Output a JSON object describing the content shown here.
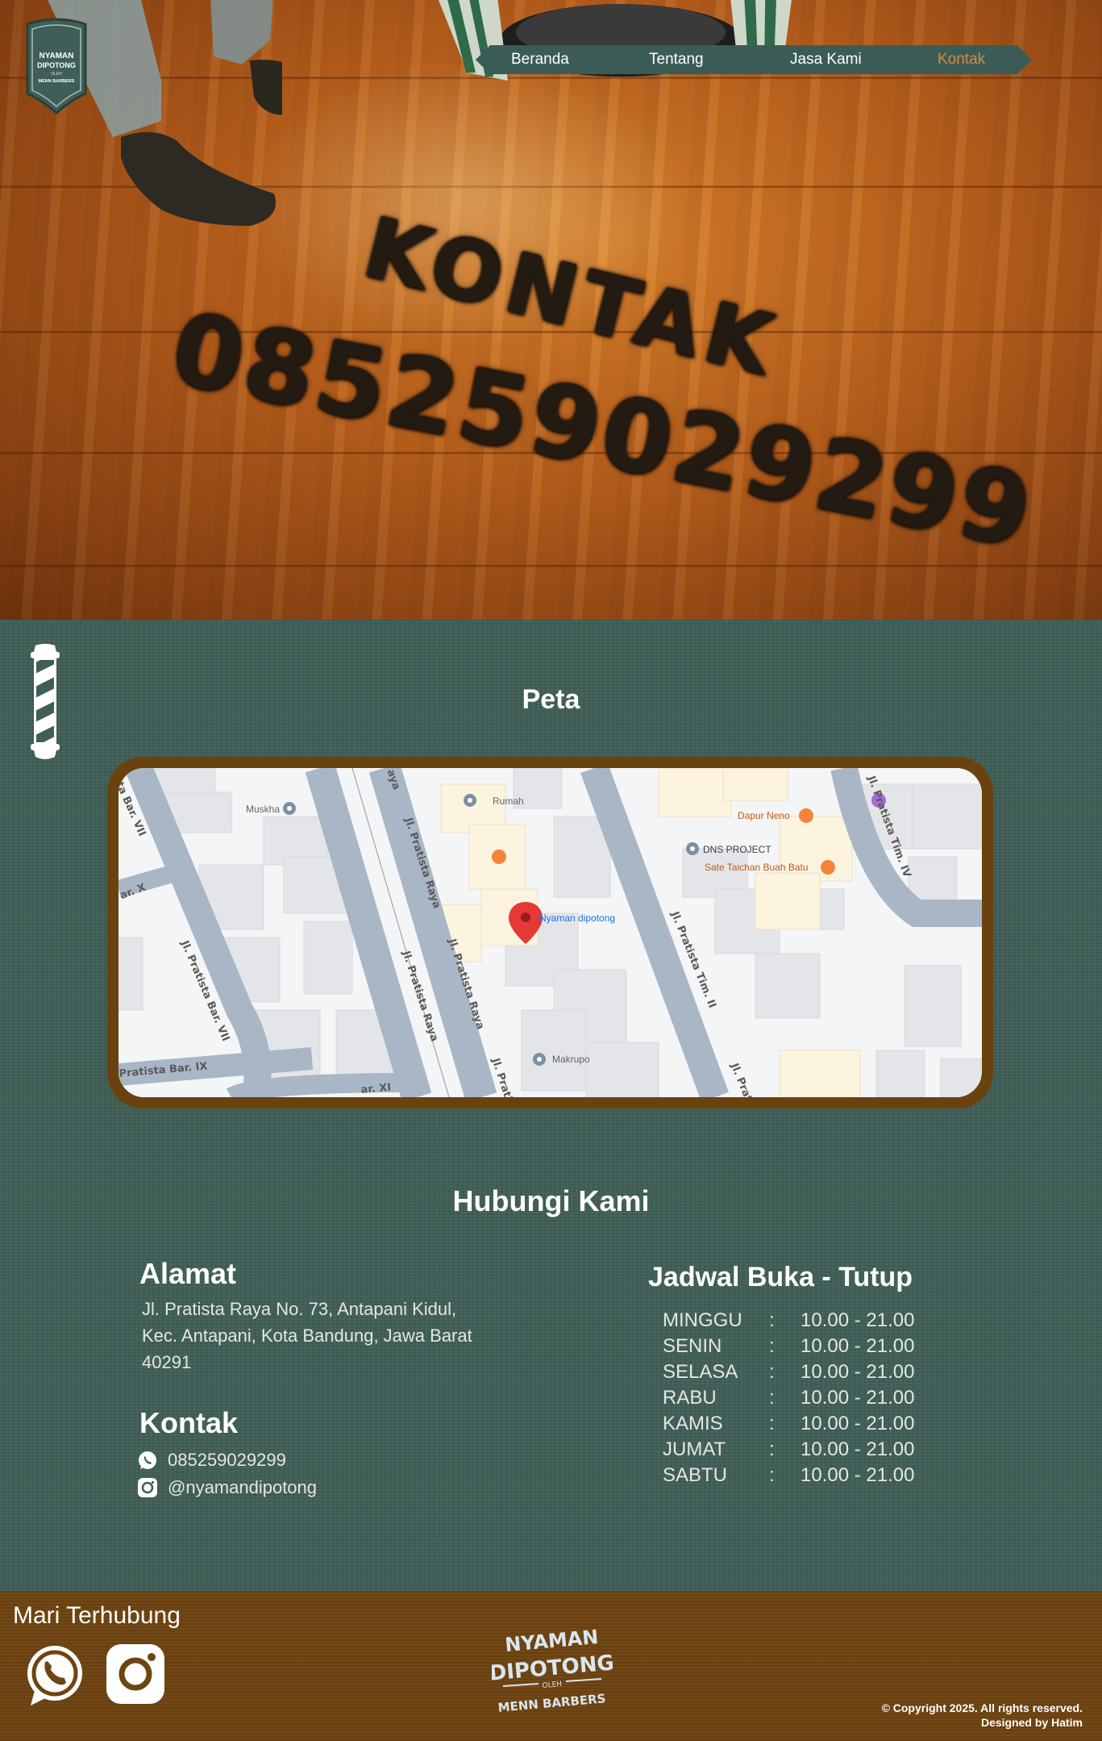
{
  "nav": {
    "items": [
      {
        "label": "Beranda",
        "active": false
      },
      {
        "label": "Tentang",
        "active": false
      },
      {
        "label": "Jasa Kami",
        "active": false
      },
      {
        "label": "Kontak",
        "active": true
      }
    ]
  },
  "logo": {
    "line1": "NYAMAN",
    "line2": "DIPOTONG",
    "line3": "OLEH",
    "line4": "MENN BARBERS"
  },
  "hero": {
    "headline": "KONTAK",
    "phone": "085259029299"
  },
  "peta": {
    "title": "Peta",
    "places": {
      "muskha": "Muskha",
      "rumah": "Rumah",
      "dapur_neno": "Dapur Neno",
      "dns_project": "DNS PROJECT",
      "sate": "Sate Taichan Buah Batu",
      "pin": "Nyaman dipotong",
      "makrupo": "Makrupo"
    },
    "roads": {
      "bar_vii_top": "sta Bar. VII",
      "bar_x": "ar. X",
      "raya_top": "aya",
      "raya_a": "Jl. Pratista Raya",
      "raya_b": "Jl. Pratista Raya",
      "raya_c": "Jl. Pratista Raya",
      "raya_d": "Jl. Pratista",
      "bar_vii": "Jl. Pratista Bar. VII",
      "bar_ix": "Pratista Bar. IX",
      "bar_xi": "ar. XI",
      "tim_ii": "Jl. Pratista Tim. II",
      "tim_ii_b": "Jl. Pratis",
      "tim_iv": "Jl. Pratista Tim. IV"
    }
  },
  "hubungi": {
    "title": "Hubungi Kami",
    "alamat_title": "Alamat",
    "alamat_lines": [
      "Jl. Pratista Raya No. 73, Antapani Kidul,",
      "Kec. Antapani, Kota Bandung, Jawa Barat",
      "40291"
    ],
    "kontak_title": "Kontak",
    "whatsapp": "085259029299",
    "instagram": "@nyamandipotong",
    "jadwal_title": "Jadwal Buka - Tutup",
    "schedule": [
      {
        "day": "MINGGU",
        "sep": ":",
        "hours": "10.00 - 21.00"
      },
      {
        "day": "SENIN",
        "sep": ":",
        "hours": "10.00 - 21.00"
      },
      {
        "day": "SELASA",
        "sep": ":",
        "hours": "10.00 - 21.00"
      },
      {
        "day": "RABU",
        "sep": ":",
        "hours": "10.00 - 21.00"
      },
      {
        "day": "KAMIS",
        "sep": ":",
        "hours": "10.00 - 21.00"
      },
      {
        "day": "JUMAT",
        "sep": ":",
        "hours": "10.00 - 21.00"
      },
      {
        "day": "SABTU",
        "sep": ":",
        "hours": "10.00 - 21.00"
      }
    ]
  },
  "footer": {
    "title": "Mari Terhubung",
    "logo_line1": "NYAMAN",
    "logo_line2": "DIPOTONG",
    "logo_line3": "OLEH",
    "logo_line4": "MENN BARBERS",
    "copyright": "© Copyright 2025. All rights reserved.",
    "designer": "Designed by Hatim"
  },
  "colors": {
    "green": "#3f5e57",
    "brown": "#6e4412",
    "nav_active": "#d58b3f",
    "map_frame": "#6a420f"
  }
}
